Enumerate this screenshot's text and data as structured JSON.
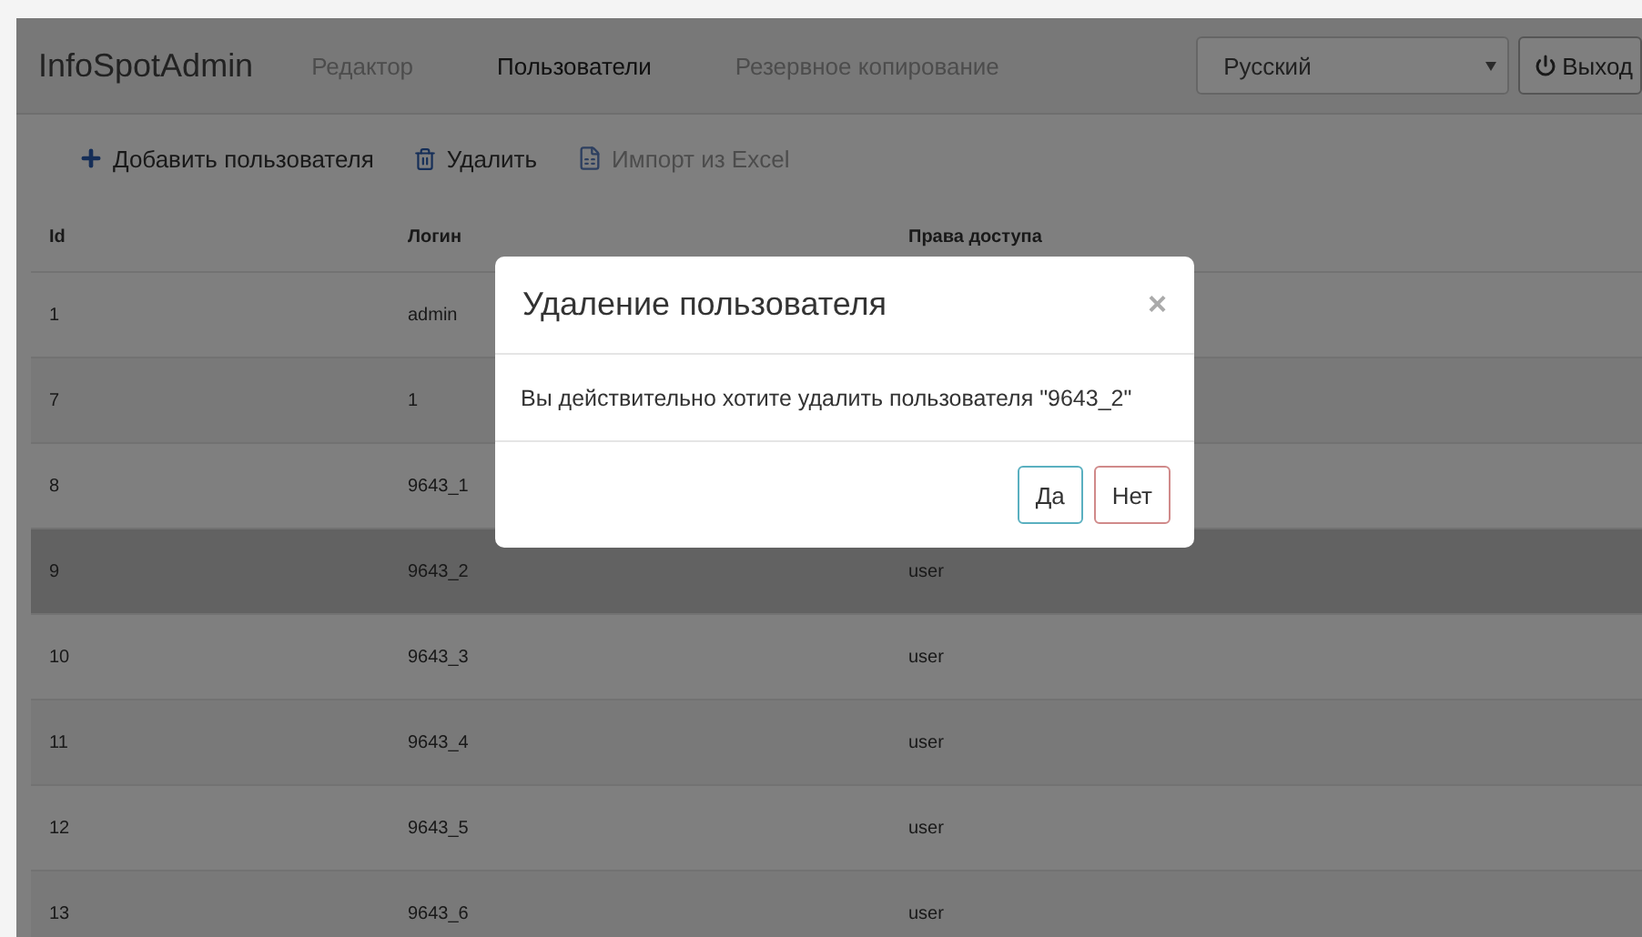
{
  "navbar": {
    "brand": "InfoSpotAdmin",
    "items": [
      {
        "label": "Редактор",
        "selected": false
      },
      {
        "label": "Пользователи",
        "selected": true
      },
      {
        "label": "Резервное копирование",
        "selected": false
      }
    ],
    "language": {
      "value": "Русский"
    },
    "logout": "Выход"
  },
  "toolbar": [
    {
      "kind": "add",
      "label": "Добавить пользователя",
      "disabled": false
    },
    {
      "kind": "delete",
      "label": "Удалить",
      "disabled": false
    },
    {
      "kind": "import",
      "label": "Импорт из Excel",
      "disabled": true
    }
  ],
  "table": {
    "columns": [
      "Id",
      "Логин",
      "Права доступа"
    ],
    "rows": [
      {
        "id": "1",
        "login": "admin",
        "selected": false
      },
      {
        "id": "7",
        "login": "1",
        "selected": false
      },
      {
        "id": "8",
        "login": "9643_1",
        "selected": false
      },
      {
        "id": "9",
        "login": "9643_2",
        "rights": "user",
        "selected": true
      },
      {
        "id": "10",
        "login": "9643_3",
        "rights": "user",
        "selected": false
      },
      {
        "id": "11",
        "login": "9643_4",
        "rights": "user",
        "selected": false
      },
      {
        "id": "12",
        "login": "9643_5",
        "rights": "user",
        "selected": false
      },
      {
        "id": "13",
        "login": "9643_6",
        "rights": "user",
        "selected": false
      }
    ]
  },
  "dialog": {
    "title": "Удаление пользователя",
    "close": "×",
    "message": "Вы действительно хотите удалить пользователя \"9643_2\"",
    "buttons": [
      {
        "kind": "confirm",
        "label": "Да"
      },
      {
        "kind": "cancel",
        "label": "Нет"
      }
    ]
  }
}
